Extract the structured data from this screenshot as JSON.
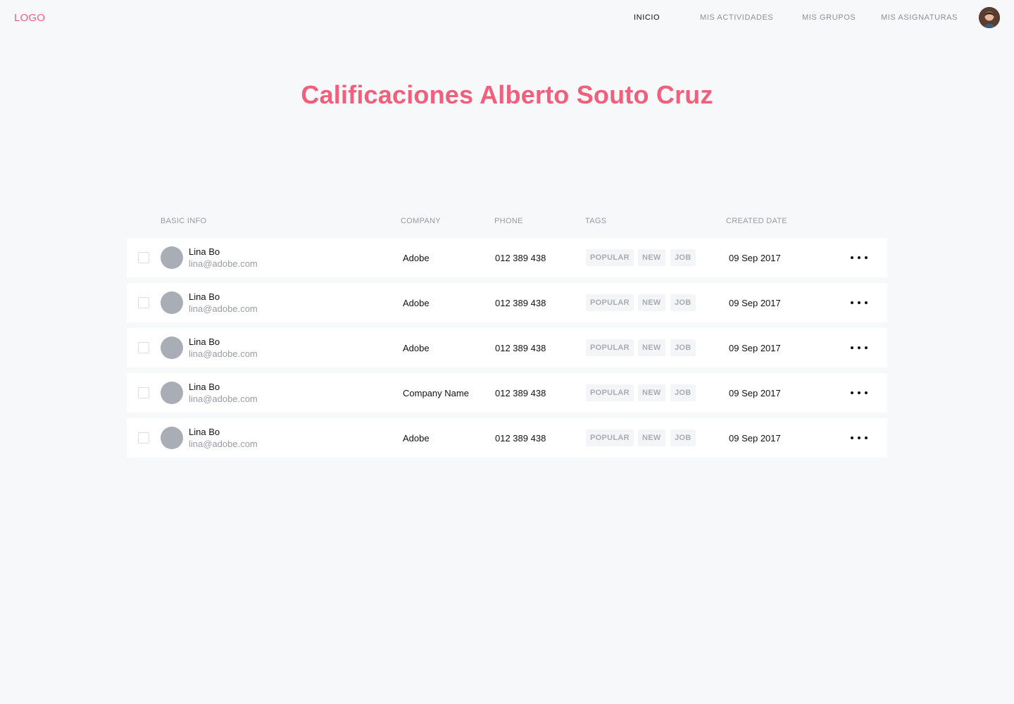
{
  "header": {
    "logo": "LOGO",
    "nav": [
      "INICIO",
      "MIS ACTIVIDADES",
      "MIS GRUPOS",
      "MIS ASIGNATURAS"
    ],
    "active_nav": "INICIO"
  },
  "page": {
    "title": "Calificaciones Alberto Souto Cruz"
  },
  "table": {
    "columns": [
      "BASIC INFO",
      "COMPANY",
      "PHONE",
      "TAGS",
      "CREATED DATE"
    ],
    "rows": [
      {
        "name": "Lina Bo",
        "email": "lina@adobe.com",
        "company": "Adobe",
        "phone": "012 389 438",
        "tags": [
          "POPULAR",
          "NEW",
          "JOB"
        ],
        "date": "09 Sep 2017"
      },
      {
        "name": "Lina Bo",
        "email": "lina@adobe.com",
        "company": "Adobe",
        "phone": "012 389 438",
        "tags": [
          "POPULAR",
          "NEW",
          "JOB"
        ],
        "date": "09 Sep 2017"
      },
      {
        "name": "Lina Bo",
        "email": "lina@adobe.com",
        "company": "Adobe",
        "phone": "012 389 438",
        "tags": [
          "POPULAR",
          "NEW",
          "JOB"
        ],
        "date": "09 Sep 2017"
      },
      {
        "name": "Lina Bo",
        "email": "lina@adobe.com",
        "company": "Company Name",
        "phone": "012 389 438",
        "tags": [
          "POPULAR",
          "NEW",
          "JOB"
        ],
        "date": "09 Sep 2017"
      },
      {
        "name": "Lina Bo",
        "email": "lina@adobe.com",
        "company": "Adobe",
        "phone": "012 389 438",
        "tags": [
          "POPULAR",
          "NEW",
          "JOB"
        ],
        "date": "09 Sep 2017"
      }
    ]
  },
  "colors": {
    "accent": "#f0607c",
    "background": "#f7f8fa",
    "row_background": "#ffffff",
    "muted_text": "#9a9ca4"
  }
}
